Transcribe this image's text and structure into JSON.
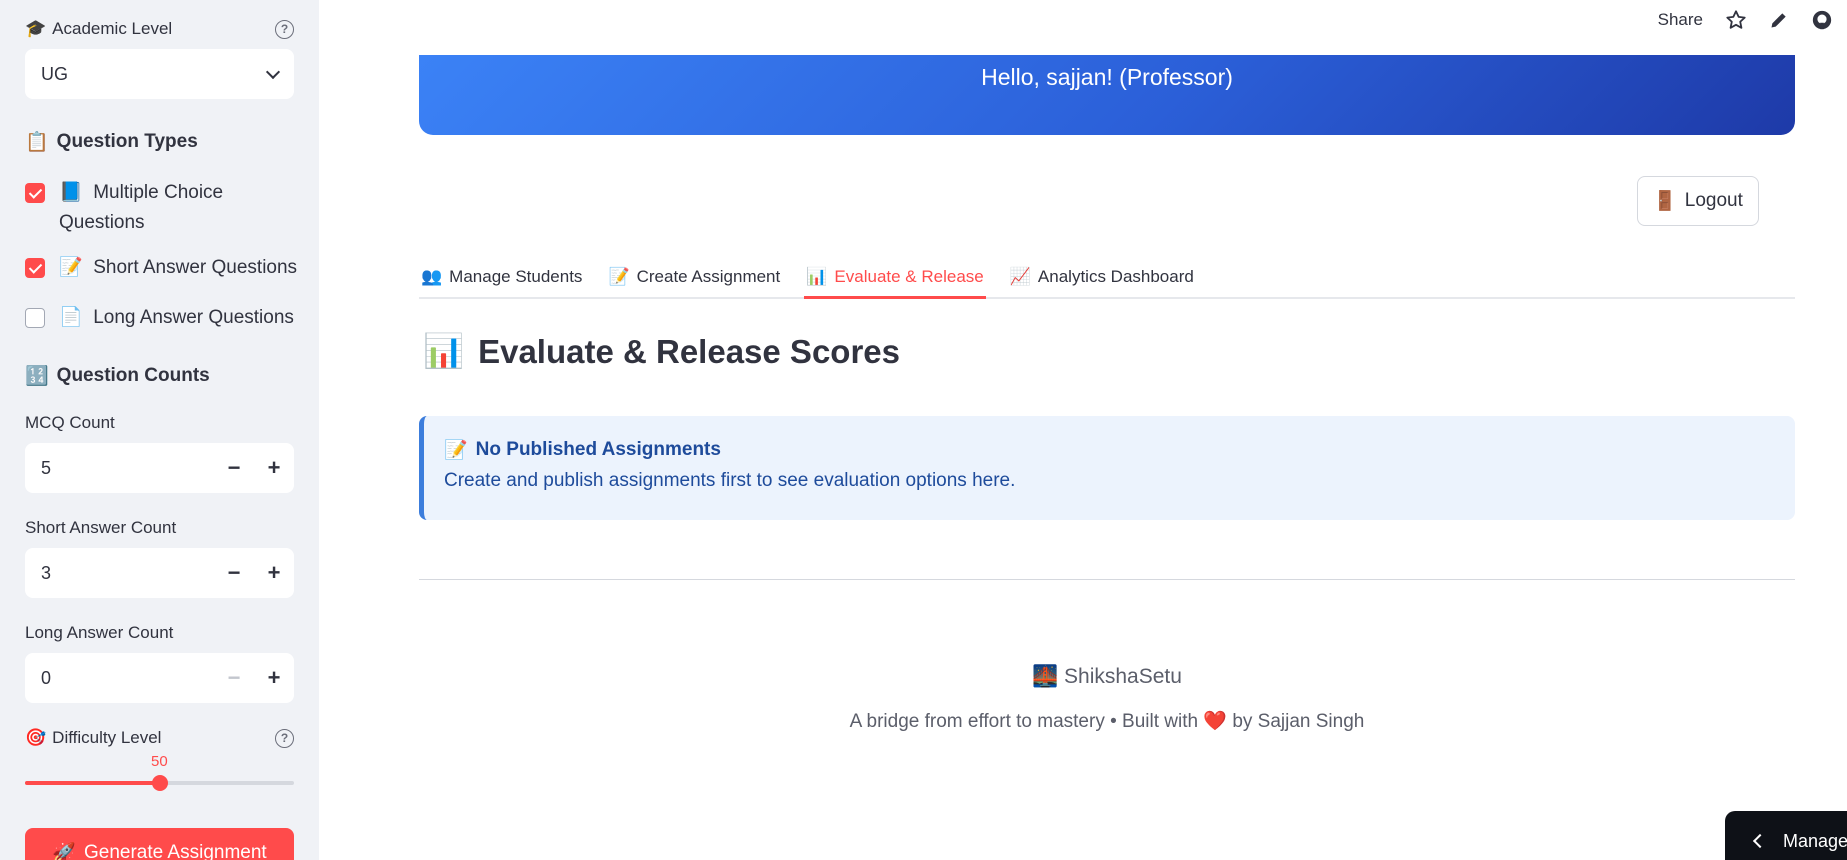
{
  "sidebar": {
    "academic_level": {
      "label": "Academic Level",
      "icon": "🎓",
      "value": "UG"
    },
    "question_types": {
      "heading": "Question Types",
      "icon": "📋",
      "items": [
        {
          "icon": "📘",
          "label": "Multiple Choice Questions",
          "checked": true
        },
        {
          "icon": "📝",
          "label": "Short Answer Questions",
          "checked": true
        },
        {
          "icon": "📄",
          "label": "Long Answer Questions",
          "checked": false
        }
      ]
    },
    "question_counts": {
      "heading": "Question Counts",
      "icon": "🔢",
      "mcq": {
        "label": "MCQ Count",
        "value": "5"
      },
      "short": {
        "label": "Short Answer Count",
        "value": "3"
      },
      "long": {
        "label": "Long Answer Count",
        "value": "0"
      }
    },
    "difficulty": {
      "label": "Difficulty Level",
      "icon": "🎯",
      "value": "50",
      "fraction": 0.5
    },
    "generate_button": {
      "icon": "🚀",
      "label": "Generate Assignment"
    }
  },
  "topbar": {
    "share": "Share"
  },
  "banner": {
    "greeting": "Hello, sajjan! (Professor)"
  },
  "logout": {
    "icon": "🚪",
    "label": "Logout"
  },
  "tabs": [
    {
      "icon": "👥",
      "label": "Manage Students"
    },
    {
      "icon": "📝",
      "label": "Create Assignment"
    },
    {
      "icon": "📊",
      "label": "Evaluate & Release"
    },
    {
      "icon": "📈",
      "label": "Analytics Dashboard"
    }
  ],
  "page": {
    "title": "Evaluate & Release Scores",
    "title_icon": "📊",
    "info": {
      "icon": "📝",
      "title": "No Published Assignments",
      "text": "Create and publish assignments first to see evaluation options here."
    }
  },
  "footer": {
    "brand": "ShikshaSetu",
    "brand_icon": "🌉",
    "sub_before": "A bridge from effort to mastery • Built with",
    "heart": "❤️",
    "sub_after": "by Sajjan Singh"
  },
  "manage_app": {
    "label": "Manage"
  },
  "colors": {
    "accent": "#ff4b4b",
    "info_bg": "#ecf3fd",
    "info_text": "#1e4b9b",
    "banner_start": "#3b82f6",
    "banner_end": "#1e3aa8"
  }
}
